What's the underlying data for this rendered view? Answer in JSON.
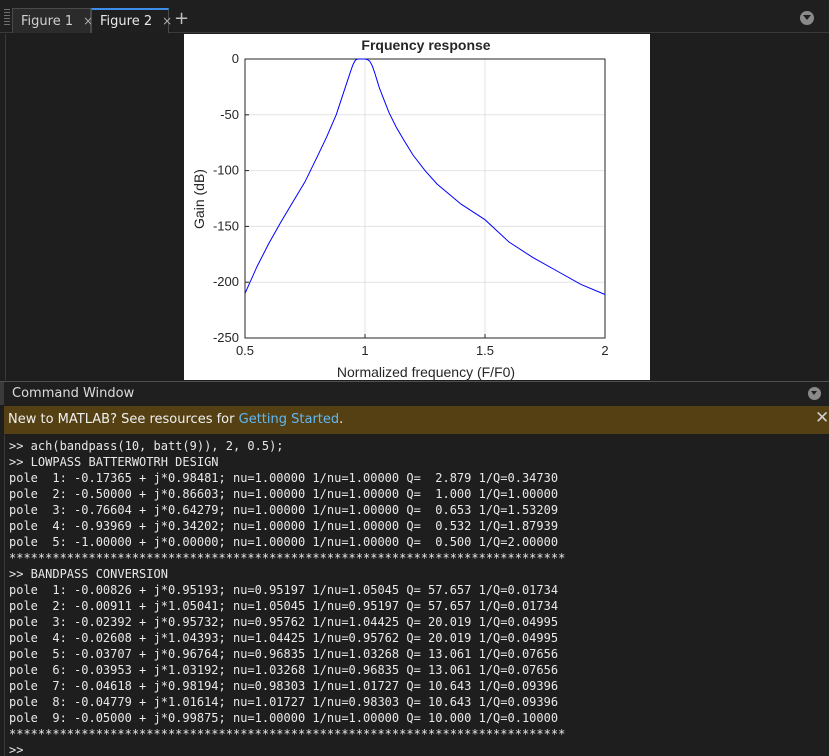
{
  "figure_tabs": [
    {
      "label": "Figure 1",
      "close": "×",
      "active": false
    },
    {
      "label": "Figure 2",
      "close": "×",
      "active": true
    }
  ],
  "add_tab_label": "+",
  "icons": {
    "tab_menu": "chevron-down-circle-icon",
    "cmd_menu": "chevron-down-circle-icon",
    "banner_close": "close-icon"
  },
  "chart_data": {
    "type": "line",
    "title": "Frquency response",
    "xlabel": "Normalized frequency (F/F0)",
    "ylabel": "Gain (dB)",
    "xlim": [
      0.5,
      2
    ],
    "ylim": [
      -250,
      0
    ],
    "xticks": [
      "0.5",
      "1",
      "1.5",
      "2"
    ],
    "yticks": [
      "0",
      "-50",
      "-100",
      "-150",
      "-200",
      "-250"
    ],
    "grid": true,
    "series": [
      {
        "color": "#0000ff",
        "x": [
          0.5,
          0.55,
          0.6,
          0.65,
          0.7,
          0.75,
          0.8,
          0.84,
          0.88,
          0.9,
          0.92,
          0.94,
          0.95,
          0.96,
          0.97,
          0.98,
          0.99,
          1.0,
          1.01,
          1.02,
          1.03,
          1.04,
          1.05,
          1.06,
          1.08,
          1.1,
          1.13,
          1.16,
          1.2,
          1.25,
          1.3,
          1.4,
          1.5,
          1.6,
          1.7,
          1.8,
          1.9,
          2.0
        ],
        "y": [
          -210,
          -186,
          -165,
          -146,
          -128,
          -110,
          -88,
          -70,
          -50,
          -37,
          -24,
          -11,
          -5,
          -1,
          0,
          0,
          0,
          0,
          -0.5,
          -2,
          -6,
          -12,
          -19,
          -26,
          -37,
          -48,
          -61,
          -72,
          -86,
          -100,
          -112,
          -130,
          -144,
          -164,
          -178,
          -190,
          -202,
          -211
        ]
      }
    ]
  },
  "command_window": {
    "title": "Command Window",
    "banner_text": "New to MATLAB? See resources for ",
    "banner_link": "Getting Started",
    "banner_suffix": ".",
    "close_glyph": "✕",
    "lines": [
      ">> ach(bandpass(10, batt(9)), 2, 0.5);",
      ">> LOWPASS BATTERWOTRH DESIGN",
      "pole  1: -0.17365 + j*0.98481; nu=1.00000 1/nu=1.00000 Q=  2.879 1/Q=0.34730",
      "pole  2: -0.50000 + j*0.86603; nu=1.00000 1/nu=1.00000 Q=  1.000 1/Q=1.00000",
      "pole  3: -0.76604 + j*0.64279; nu=1.00000 1/nu=1.00000 Q=  0.653 1/Q=1.53209",
      "pole  4: -0.93969 + j*0.34202; nu=1.00000 1/nu=1.00000 Q=  0.532 1/Q=1.87939",
      "pole  5: -1.00000 + j*0.00000; nu=1.00000 1/nu=1.00000 Q=  0.500 1/Q=2.00000",
      "*****************************************************************************",
      ">> BANDPASS CONVERSION",
      "pole  1: -0.00826 + j*0.95193; nu=0.95197 1/nu=1.05045 Q= 57.657 1/Q=0.01734",
      "pole  2: -0.00911 + j*1.05041; nu=1.05045 1/nu=0.95197 Q= 57.657 1/Q=0.01734",
      "pole  3: -0.02392 + j*0.95732; nu=0.95762 1/nu=1.04425 Q= 20.019 1/Q=0.04995",
      "pole  4: -0.02608 + j*1.04393; nu=1.04425 1/nu=0.95762 Q= 20.019 1/Q=0.04995",
      "pole  5: -0.03707 + j*0.96764; nu=0.96835 1/nu=1.03268 Q= 13.061 1/Q=0.07656",
      "pole  6: -0.03953 + j*1.03192; nu=1.03268 1/nu=0.96835 Q= 13.061 1/Q=0.07656",
      "pole  7: -0.04618 + j*0.98194; nu=0.98303 1/nu=1.01727 Q= 10.643 1/Q=0.09396",
      "pole  8: -0.04779 + j*1.01614; nu=1.01727 1/nu=0.98303 Q= 10.643 1/Q=0.09396",
      "pole  9: -0.05000 + j*0.99875; nu=1.00000 1/nu=1.00000 Q= 10.000 1/Q=0.10000",
      "*****************************************************************************"
    ],
    "prompt": ">>"
  }
}
